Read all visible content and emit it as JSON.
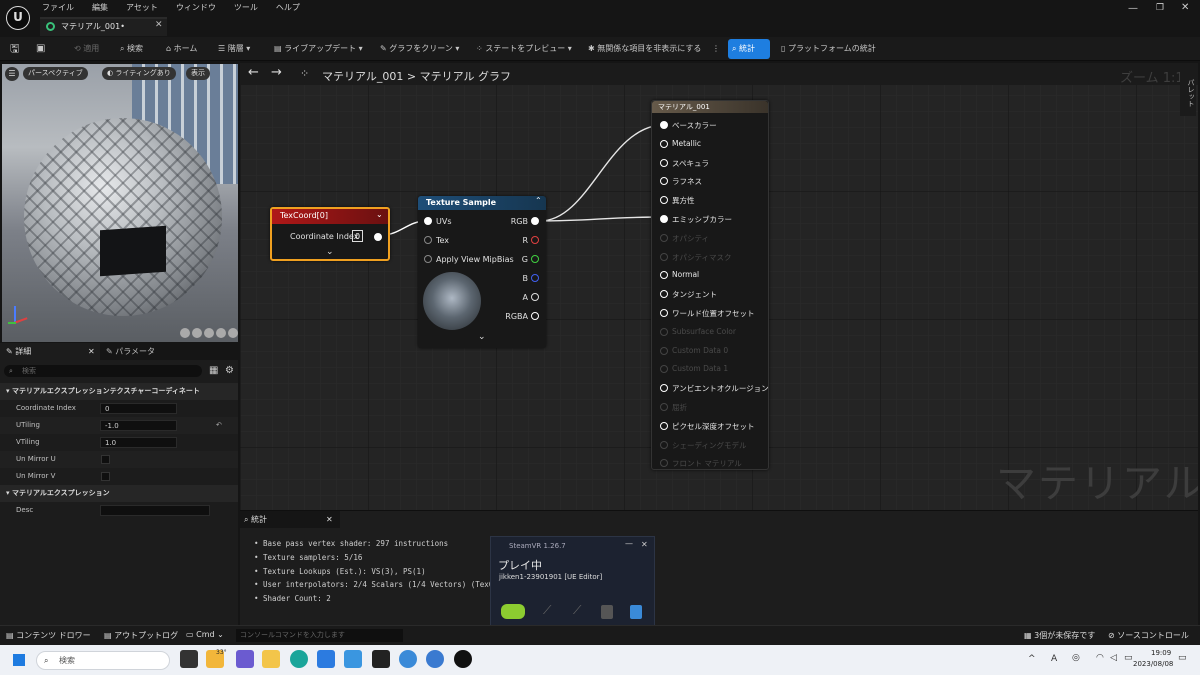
{
  "app": {
    "title_tab": "マテリアル_001•",
    "menu": [
      "ファイル",
      "編集",
      "アセット",
      "ウィンドウ",
      "ツール",
      "ヘルプ"
    ]
  },
  "toolbar": {
    "apply": "適用",
    "search": "検索",
    "home": "ホーム",
    "hierarchy": "階層",
    "live_update": "ライブアップデート",
    "clean_graph": "グラフをクリーン",
    "preview_state": "ステートをプレビュー",
    "hide_unrelated": "無関係な項目を非表示にする",
    "stats": "統計",
    "platform_stats": "プラットフォームの統計"
  },
  "viewport": {
    "perspective": "パースペクティブ",
    "lighting": "ライティングあり",
    "show": "表示"
  },
  "details": {
    "tab_details": "詳細",
    "tab_params": "パラメータ",
    "search_placeholder": "検索",
    "section1": "マテリアルエクスプレッションテクスチャーコーディネート",
    "rows": [
      {
        "label": "Coordinate Index",
        "value": "0"
      },
      {
        "label": "UTiling",
        "value": "-1.0"
      },
      {
        "label": "VTiling",
        "value": "1.0"
      },
      {
        "label": "Un Mirror U",
        "value": ""
      },
      {
        "label": "Un Mirror V",
        "value": ""
      }
    ],
    "section2": "マテリアルエクスプレッション",
    "desc_label": "Desc"
  },
  "graph": {
    "breadcrumb_asset": "マテリアル_001",
    "breadcrumb_sep": ">",
    "breadcrumb_graph": "マテリアル グラフ",
    "zoom": "ズーム 1:1",
    "watermark": "マテリアル",
    "side_tab": "パレット",
    "texcoord": {
      "title": "TexCoord[0]",
      "pin_label": "Coordinate Index",
      "pin_value": "0"
    },
    "texsample": {
      "title": "Texture Sample",
      "inputs": [
        "UVs",
        "Tex",
        "Apply View MipBias"
      ],
      "outputs": [
        {
          "label": "RGB",
          "color": "#ffffff"
        },
        {
          "label": "R",
          "color": "#e04040"
        },
        {
          "label": "G",
          "color": "#40d040"
        },
        {
          "label": "B",
          "color": "#4060f0"
        },
        {
          "label": "A",
          "color": "#dddddd"
        },
        {
          "label": "RGBA",
          "color": "#ffffff"
        }
      ]
    },
    "material": {
      "title": "マテリアル_001",
      "pins": [
        {
          "label": "ベースカラー",
          "active": true,
          "connected": true
        },
        {
          "label": "Metallic",
          "active": true,
          "connected": false
        },
        {
          "label": "スペキュラ",
          "active": true,
          "connected": false
        },
        {
          "label": "ラフネス",
          "active": true,
          "connected": false
        },
        {
          "label": "異方性",
          "active": true,
          "connected": false
        },
        {
          "label": "エミッシブカラー",
          "active": true,
          "connected": true
        },
        {
          "label": "オパシティ",
          "active": false,
          "connected": false
        },
        {
          "label": "オパシティマスク",
          "active": false,
          "connected": false
        },
        {
          "label": "Normal",
          "active": true,
          "connected": false
        },
        {
          "label": "タンジェント",
          "active": true,
          "connected": false
        },
        {
          "label": "ワールド位置オフセット",
          "active": true,
          "connected": false
        },
        {
          "label": "Subsurface Color",
          "active": false,
          "connected": false
        },
        {
          "label": "Custom Data 0",
          "active": false,
          "connected": false
        },
        {
          "label": "Custom Data 1",
          "active": false,
          "connected": false
        },
        {
          "label": "アンビエントオクルージョン",
          "active": true,
          "connected": false
        },
        {
          "label": "屈折",
          "active": false,
          "connected": false
        },
        {
          "label": "ピクセル深度オフセット",
          "active": true,
          "connected": false
        },
        {
          "label": "シェーディングモデル",
          "active": false,
          "connected": false
        },
        {
          "label": "フロント マテリアル",
          "active": false,
          "connected": false
        }
      ]
    }
  },
  "stats": {
    "tab": "統計",
    "lines": [
      "Base pass vertex shader: 297 instructions",
      "Texture samplers: 5/16",
      "Texture Lookups (Est.): VS(3), PS(1)",
      "User interpolators: 2/4 Scalars (1/4 Vectors) (TexCo",
      "Shader Count: 2"
    ]
  },
  "steamvr": {
    "title": "SteamVR 1.26.7",
    "status": "プレイ中",
    "app": "jikken1-23901901 [UE Editor]"
  },
  "statusbar": {
    "content_drawer": "コンテンツ ドロワー",
    "output_log": "アウトプットログ",
    "cmd": "Cmd",
    "console_placeholder": "コンソールコマンドを入力します",
    "unsaved": "3個が未保存です",
    "source_control": "ソースコントロール"
  },
  "taskbar": {
    "search": "検索",
    "weather": "33°",
    "time": "19:09",
    "date": "2023/08/08",
    "ime": "A"
  }
}
